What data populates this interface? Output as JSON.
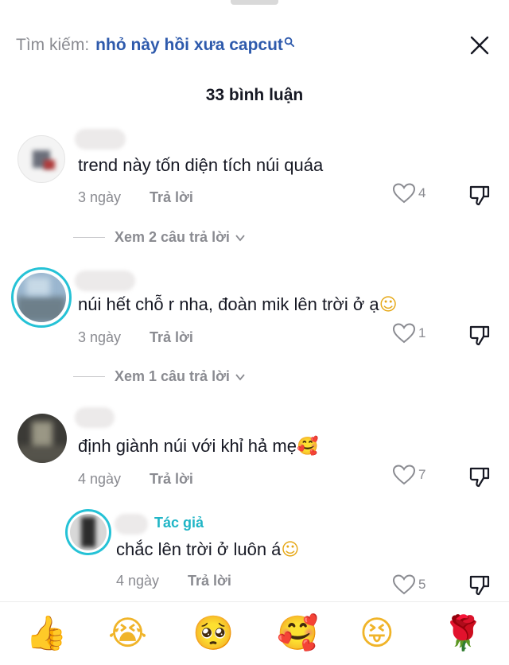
{
  "search": {
    "prefix": "Tìm kiếm:",
    "query": "nhỏ này hồi xưa capcut"
  },
  "header": {
    "comment_count": "33 bình luận"
  },
  "comments": [
    {
      "text": "trend này tốn diện tích núi quáa",
      "time": "3 ngày",
      "reply_label": "Trả lời",
      "likes": "4",
      "view_replies": "Xem 2 câu trả lời"
    },
    {
      "text": "núi hết chỗ r nha, đoàn mik lên trời ở ạ",
      "emoji": "☺",
      "time": "3 ngày",
      "reply_label": "Trả lời",
      "likes": "1",
      "view_replies": "Xem 1 câu trả lời"
    },
    {
      "text": "định giành núi với khỉ hả mẹ",
      "emoji": "🥰",
      "time": "4 ngày",
      "reply_label": "Trả lời",
      "likes": "7"
    }
  ],
  "reply": {
    "author_badge": "Tác giả",
    "text": "chắc lên trời ở luôn á",
    "emoji": "☺",
    "time": "4 ngày",
    "reply_label": "Trả lời",
    "likes": "5"
  },
  "emoji_bar": [
    "👍",
    "😭",
    "🥺",
    "🥰",
    "😝",
    "🌹"
  ],
  "colors": {
    "query_blue": "#2e5aac",
    "author_teal": "#20b5c6",
    "muted_gray": "#8a8b91"
  }
}
